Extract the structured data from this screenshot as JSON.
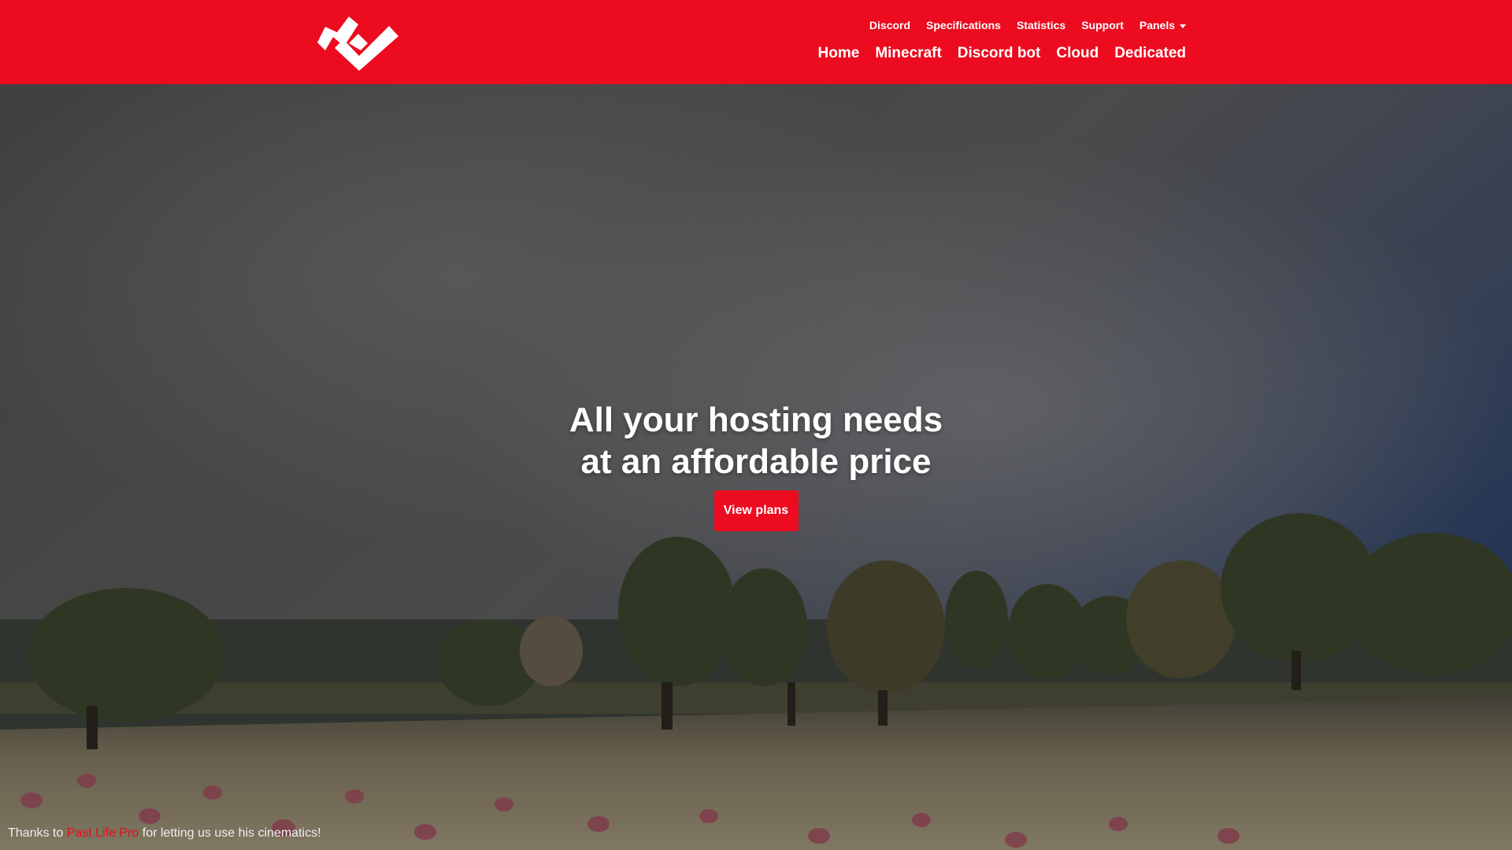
{
  "header": {
    "logo_icon": "checkmark-logo-icon",
    "brand_color": "#ec0b1f",
    "top_links": [
      {
        "label": "Discord"
      },
      {
        "label": "Specifications"
      },
      {
        "label": "Statistics"
      },
      {
        "label": "Support"
      },
      {
        "label": "Panels"
      }
    ],
    "main_links": [
      {
        "label": "Home"
      },
      {
        "label": "Minecraft"
      },
      {
        "label": "Discord bot"
      },
      {
        "label": "Cloud"
      },
      {
        "label": "Dedicated"
      }
    ]
  },
  "hero": {
    "headline_line1": "All your hosting needs",
    "headline_line2": "at an affordable price",
    "cta_label": "View plans"
  },
  "credits": {
    "prefix": "Thanks to ",
    "link": "Past Life Pro",
    "suffix": " for letting us use his cinematics!"
  }
}
